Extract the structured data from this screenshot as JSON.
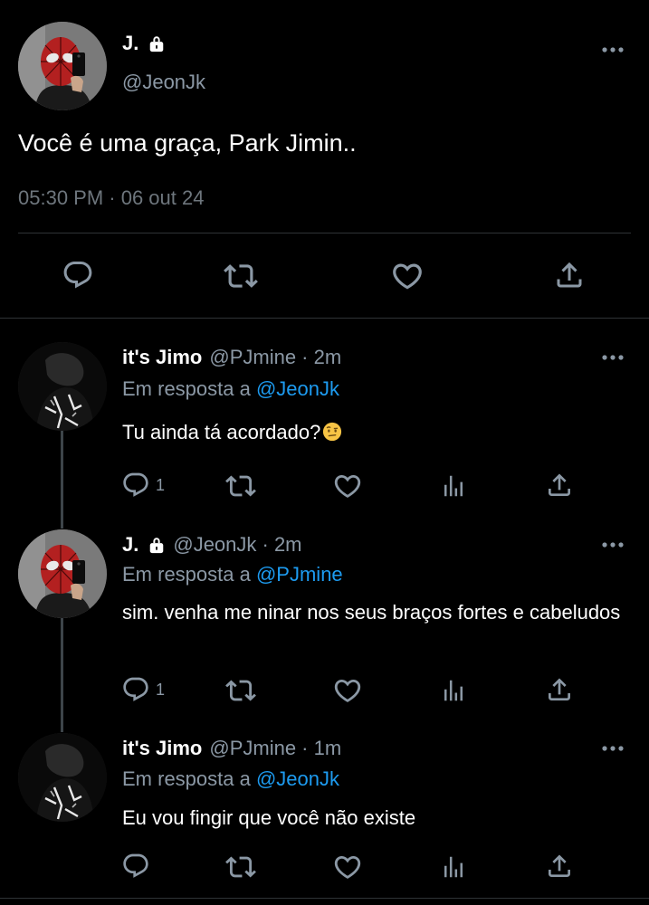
{
  "main_tweet": {
    "display_name": "J.",
    "handle": "@JeonJk",
    "text": "Você é uma graça, Park Jimin..",
    "timestamp": "05:30 PM · 06 out 24",
    "icons": [
      "lock-icon",
      "more-icon",
      "reply-icon",
      "retweet-icon",
      "like-icon",
      "share-icon"
    ]
  },
  "replies": [
    {
      "display_name": "it's Jimo",
      "handle_meta": "@PJmine · 2m",
      "reply_prefix": "Em resposta a",
      "reply_to": "@JeonJk",
      "text": "Tu ainda tá acordado?",
      "emoji": "face-with-raised-eyebrow-icon",
      "reply_count": "1"
    },
    {
      "display_name": "J.",
      "handle_meta": "@JeonJk · 2m",
      "reply_prefix": "Em resposta a",
      "reply_to": "@PJmine",
      "text": "sim. venha me ninar nos seus braços fortes e cabeludos",
      "reply_count": "1"
    },
    {
      "display_name": "it's Jimo",
      "handle_meta": "@PJmine · 1m",
      "reply_prefix": "Em resposta a",
      "reply_to": "@JeonJk",
      "text": "Eu vou fingir que você não existe",
      "reply_count": ""
    }
  ],
  "colors": {
    "background": "#000000",
    "text": "#e7e9ea",
    "secondary_text": "#8b98a5",
    "mention": "#1d9bf0",
    "icon": "#8b98a5",
    "divider": "#2f3336"
  }
}
